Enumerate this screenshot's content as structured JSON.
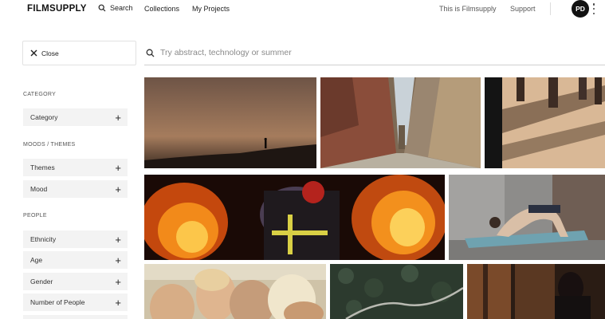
{
  "nav": {
    "brand": "FILMSUPPLY",
    "search_label": "Search",
    "collections_label": "Collections",
    "my_projects_label": "My Projects",
    "about_label": "This is Filmsupply",
    "support_label": "Support",
    "avatar_initials": "PD"
  },
  "sidebar": {
    "close_label": "Close",
    "category_heading": "CATEGORY",
    "category_item": "Category",
    "moods_heading": "MOODS / THEMES",
    "themes_item": "Themes",
    "mood_item": "Mood",
    "people_heading": "PEOPLE",
    "ethnicity_item": "Ethnicity",
    "age_item": "Age",
    "gender_item": "Gender",
    "number_item": "Number of People"
  },
  "search": {
    "placeholder": "Try abstract, technology or summer"
  },
  "results": [
    {
      "subject": "desert-silhouette-dusk"
    },
    {
      "subject": "narrow-alley-street"
    },
    {
      "subject": "street-shadows-sepia"
    },
    {
      "subject": "firefighter-in-flames"
    },
    {
      "subject": "woman-yoga-pose"
    },
    {
      "subject": "family-faces-closeup"
    },
    {
      "subject": "aerial-forest-road"
    },
    {
      "subject": "woman-by-window-shadow"
    }
  ],
  "colors": {
    "accent": "#111111",
    "filter_bg": "#f3f3f3"
  }
}
